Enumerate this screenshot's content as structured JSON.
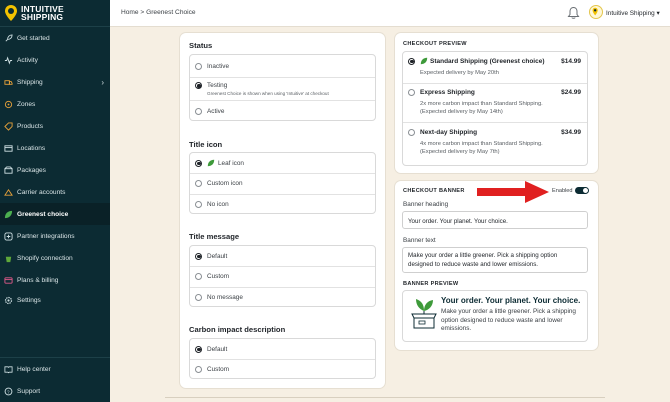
{
  "brand": {
    "line1": "INTUITIVE",
    "line2": "SHIPPING"
  },
  "breadcrumb": "Home > Greenest Choice",
  "account": {
    "name": "Intuitive Shipping"
  },
  "sidebar": {
    "items": [
      {
        "label": "Get started",
        "icon": "rocket-icon"
      },
      {
        "label": "Activity",
        "icon": "activity-icon"
      },
      {
        "label": "Shipping",
        "icon": "truck-icon"
      },
      {
        "label": "Zones",
        "icon": "zones-icon"
      },
      {
        "label": "Products",
        "icon": "tag-icon"
      },
      {
        "label": "Locations",
        "icon": "location-icon"
      },
      {
        "label": "Packages",
        "icon": "package-icon"
      },
      {
        "label": "Carrier accounts",
        "icon": "carrier-icon"
      },
      {
        "label": "Greenest choice",
        "icon": "leaf-icon"
      },
      {
        "label": "Partner integrations",
        "icon": "integration-icon"
      },
      {
        "label": "Shopify connection",
        "icon": "shopify-icon"
      },
      {
        "label": "Plans & billing",
        "icon": "billing-icon"
      },
      {
        "label": "Settings",
        "icon": "gear-icon"
      }
    ],
    "footer": [
      {
        "label": "Help center",
        "icon": "book-icon"
      },
      {
        "label": "Support",
        "icon": "help-icon"
      }
    ]
  },
  "settings": {
    "status": {
      "title": "Status",
      "options": [
        "Inactive",
        "Testing",
        "Active"
      ],
      "selected": "Testing",
      "testing_help": "Greenest Choice is shown when using 'Intuitive' at checkout"
    },
    "title_icon": {
      "title": "Title icon",
      "options": [
        "Leaf icon",
        "Custom icon",
        "No icon"
      ],
      "selected": "Leaf icon"
    },
    "title_message": {
      "title": "Title message",
      "options": [
        "Default",
        "Custom",
        "No message"
      ],
      "selected": "Default"
    },
    "carbon": {
      "title": "Carbon impact description",
      "options": [
        "Default",
        "Custom"
      ],
      "selected": "Default"
    }
  },
  "checkout_preview": {
    "heading": "CHECKOUT PREVIEW",
    "options": [
      {
        "title": "Standard Shipping (Greenest choice)",
        "price": "$14.99",
        "line1": "Expected delivery by May 20th",
        "line2": ""
      },
      {
        "title": "Express Shipping",
        "price": "$24.99",
        "line1": "2x more carbon impact than Standard Shipping.",
        "line2": "(Expected delivery by May 14th)"
      },
      {
        "title": "Next-day Shipping",
        "price": "$34.99",
        "line1": "4x more carbon impact than Standard Shipping.",
        "line2": "(Expected delivery by May 7th)"
      }
    ]
  },
  "checkout_banner": {
    "heading": "CHECKOUT BANNER",
    "enabled_label": "Enabled",
    "banner_heading_label": "Banner heading",
    "banner_heading_value": "Your order. Your planet. Your choice.",
    "banner_text_label": "Banner text",
    "banner_text_value": "Make your order a little greener. Pick a shipping option designed to reduce waste and lower emissions.",
    "preview_heading": "BANNER PREVIEW",
    "preview_title": "Your order. Your planet. Your choice.",
    "preview_text": "Make your order a little greener. Pick a shipping option designed to reduce waste and lower emissions."
  },
  "colors": {
    "sidebar_bg": "#0c2b33",
    "page_bg": "#f6efe3",
    "accent_green": "#3e9a3a",
    "annotation_red": "#e02020"
  }
}
